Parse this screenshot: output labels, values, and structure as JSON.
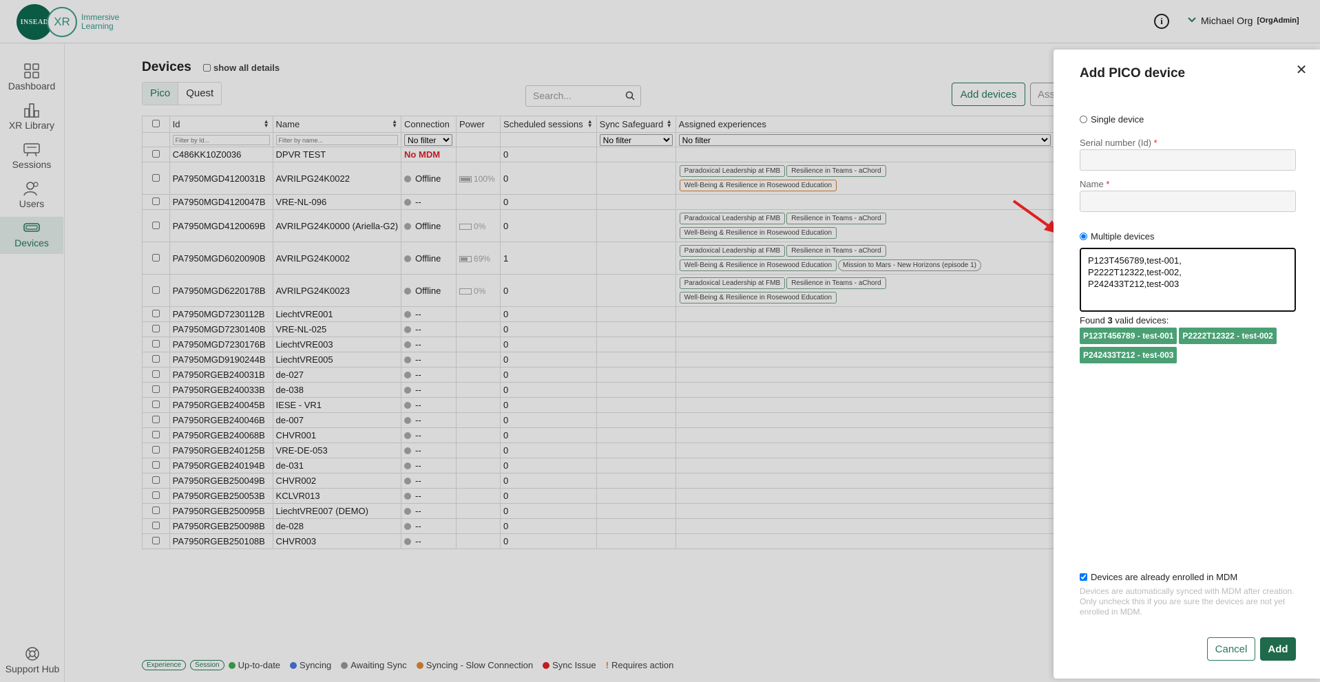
{
  "header": {
    "logo_insead": "INSEAD",
    "logo_xr": "XR",
    "logo_line1": "Immersive",
    "logo_line2": "Learning",
    "user_name": "Michael Org",
    "user_role": "[OrgAdmin]"
  },
  "sidebar": {
    "items": [
      {
        "label": "Dashboard",
        "icon": "dashboard-icon"
      },
      {
        "label": "XR Library",
        "icon": "library-icon"
      },
      {
        "label": "Sessions",
        "icon": "sessions-icon"
      },
      {
        "label": "Users",
        "icon": "users-icon"
      },
      {
        "label": "Devices",
        "icon": "devices-icon",
        "active": true
      }
    ],
    "support_label": "Support Hub"
  },
  "main": {
    "title": "Devices",
    "show_all_label": "show all details",
    "tabs": [
      "Pico",
      "Quest"
    ],
    "search_placeholder": "Search...",
    "add_devices_label": "Add devices",
    "assign_label": "Assign"
  },
  "table": {
    "columns": [
      "Id",
      "Name",
      "Connection",
      "Power",
      "Scheduled sessions",
      "Sync Safeguard",
      "Assigned experiences"
    ],
    "filter_id_placeholder": "Filter by Id...",
    "filter_name_placeholder": "Filter by name...",
    "no_filter": "No filter",
    "rows": [
      {
        "id": "C486KK10Z0036",
        "name": "DPVR TEST",
        "connection": "No MDM",
        "nomdm": true,
        "power": "",
        "sessions": "0",
        "exps": []
      },
      {
        "id": "PA7950MGD4120031B",
        "name": "AVRILPG24K0022",
        "connection": "Offline",
        "power": "100%",
        "fill": 1.0,
        "sessions": "0",
        "exps": [
          [
            "Paradoxical Leadership at FMB",
            "Resilience in Teams - aChord"
          ],
          [
            "Well-Being & Resilience in Rosewood Education"
          ]
        ],
        "orange": true
      },
      {
        "id": "PA7950MGD4120047B",
        "name": "VRE-NL-096",
        "connection": "--",
        "power": "",
        "sessions": "0",
        "exps": []
      },
      {
        "id": "PA7950MGD4120069B",
        "name": "AVRILPG24K0000 (Ariella-G2)",
        "connection": "Offline",
        "power": "0%",
        "fill": 0.0,
        "sessions": "0",
        "exps": [
          [
            "Paradoxical Leadership at FMB",
            "Resilience in Teams - aChord"
          ],
          [
            "Well-Being & Resilience in Rosewood Education"
          ]
        ]
      },
      {
        "id": "PA7950MGD6020090B",
        "name": "AVRILPG24K0002",
        "connection": "Offline",
        "power": "69%",
        "fill": 0.69,
        "sessions": "1",
        "exps": [
          [
            "Paradoxical Leadership at FMB",
            "Resilience in Teams - aChord"
          ],
          [
            "Well-Being & Resilience in Rosewood Education",
            "Mission to Mars - New Horizons (episode 1)"
          ]
        ]
      },
      {
        "id": "PA7950MGD6220178B",
        "name": "AVRILPG24K0023",
        "connection": "Offline",
        "power": "0%",
        "fill": 0.0,
        "sessions": "0",
        "exps": [
          [
            "Paradoxical Leadership at FMB",
            "Resilience in Teams - aChord"
          ],
          [
            "Well-Being & Resilience in Rosewood Education"
          ]
        ]
      },
      {
        "id": "PA7950MGD7230112B",
        "name": "LiechtVRE001",
        "connection": "--",
        "power": "",
        "sessions": "0",
        "exps": []
      },
      {
        "id": "PA7950MGD7230140B",
        "name": "VRE-NL-025",
        "connection": "--",
        "power": "",
        "sessions": "0",
        "exps": []
      },
      {
        "id": "PA7950MGD7230176B",
        "name": "LiechtVRE003",
        "connection": "--",
        "power": "",
        "sessions": "0",
        "exps": []
      },
      {
        "id": "PA7950MGD9190244B",
        "name": "LiechtVRE005",
        "connection": "--",
        "power": "",
        "sessions": "0",
        "exps": []
      },
      {
        "id": "PA7950RGEB240031B",
        "name": "de-027",
        "connection": "--",
        "power": "",
        "sessions": "0",
        "exps": []
      },
      {
        "id": "PA7950RGEB240033B",
        "name": "de-038",
        "connection": "--",
        "power": "",
        "sessions": "0",
        "exps": []
      },
      {
        "id": "PA7950RGEB240045B",
        "name": "IESE - VR1",
        "connection": "--",
        "power": "",
        "sessions": "0",
        "exps": []
      },
      {
        "id": "PA7950RGEB240046B",
        "name": "de-007",
        "connection": "--",
        "power": "",
        "sessions": "0",
        "exps": []
      },
      {
        "id": "PA7950RGEB240068B",
        "name": "CHVR001",
        "connection": "--",
        "power": "",
        "sessions": "0",
        "exps": []
      },
      {
        "id": "PA7950RGEB240125B",
        "name": "VRE-DE-053",
        "connection": "--",
        "power": "",
        "sessions": "0",
        "exps": []
      },
      {
        "id": "PA7950RGEB240194B",
        "name": "de-031",
        "connection": "--",
        "power": "",
        "sessions": "0",
        "exps": []
      },
      {
        "id": "PA7950RGEB250049B",
        "name": "CHVR002",
        "connection": "--",
        "power": "",
        "sessions": "0",
        "exps": []
      },
      {
        "id": "PA7950RGEB250053B",
        "name": "KCLVR013",
        "connection": "--",
        "power": "",
        "sessions": "0",
        "exps": []
      },
      {
        "id": "PA7950RGEB250095B",
        "name": "LiechtVRE007 (DEMO)",
        "connection": "--",
        "power": "",
        "sessions": "0",
        "exps": []
      },
      {
        "id": "PA7950RGEB250098B",
        "name": "de-028",
        "connection": "--",
        "power": "",
        "sessions": "0",
        "exps": []
      },
      {
        "id": "PA7950RGEB250108B",
        "name": "CHVR003",
        "connection": "--",
        "power": "",
        "sessions": "0",
        "exps": []
      }
    ]
  },
  "legend": {
    "experience": "Experience",
    "session": "Session",
    "items": [
      {
        "label": "Up-to-date",
        "color": "#3cb04a"
      },
      {
        "label": "Syncing",
        "color": "#4a7ae0"
      },
      {
        "label": "Awaiting Sync",
        "color": "#999999"
      },
      {
        "label": "Syncing - Slow Connection",
        "color": "#e08a3a"
      },
      {
        "label": "Sync Issue",
        "color": "#e0202a"
      }
    ],
    "requires_action": "Requires action"
  },
  "panel": {
    "title": "Add PICO device",
    "single_label": "Single device",
    "serial_label": "Serial number (Id)",
    "name_label": "Name",
    "required_mark": "*",
    "multiple_label": "Multiple devices",
    "textarea_value": "P123T456789,test-001,\nP2222T12322,test-002,\nP242433T212,test-003",
    "found_prefix": "Found",
    "found_count": "3",
    "found_suffix": "valid devices:",
    "found_devices": [
      "P123T456789 - test-001",
      "P2222T12322 - test-002",
      "P242433T212 - test-003"
    ],
    "mdm_label": "Devices are already enrolled in MDM",
    "mdm_help": "Devices are automatically synced with MDM after creation. Only uncheck this if you are sure the devices are not yet enrolled in MDM.",
    "cancel_label": "Cancel",
    "add_label": "Add"
  }
}
